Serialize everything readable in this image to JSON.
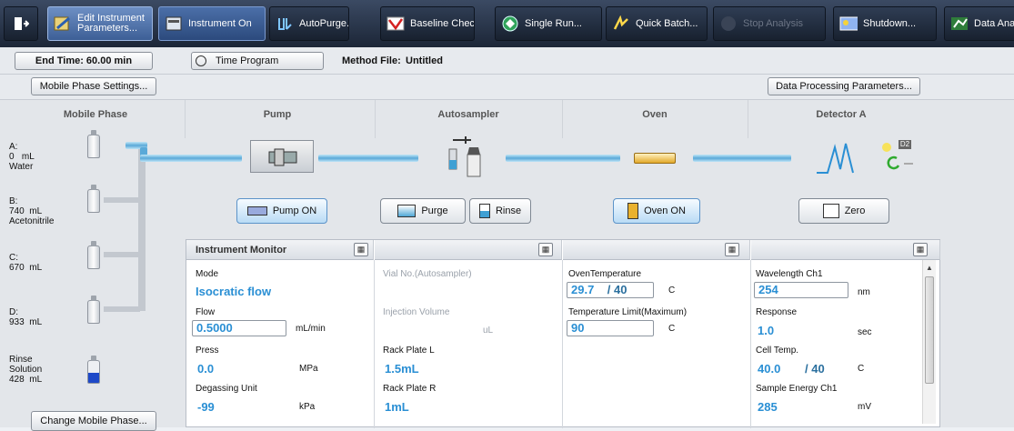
{
  "toolbar": {
    "edit_params": "Edit Instrument Parameters...",
    "instrument_on": "Instrument On",
    "autopurge": "AutoPurge...",
    "baseline_check": "Baseline Check",
    "single_run": "Single Run...",
    "quick_batch": "Quick Batch...",
    "stop_analysis": "Stop Analysis",
    "shutdown": "Shutdown...",
    "data_analysis": "Data Analy"
  },
  "row2": {
    "end_time": "End Time: 60.00 min",
    "time_program": "Time Program",
    "method_file_label": "Method File:",
    "method_file_value": "Untitled"
  },
  "row3": {
    "mobile_phase_settings": "Mobile Phase Settings...",
    "data_processing": "Data Processing Parameters..."
  },
  "columns": {
    "mobile_phase": "Mobile Phase",
    "pump": "Pump",
    "autosampler": "Autosampler",
    "oven": "Oven",
    "detector": "Detector A"
  },
  "mobile_phase": [
    {
      "letter": "A:",
      "amount": "0",
      "unit": "mL",
      "name": "Water"
    },
    {
      "letter": "B:",
      "amount": "740",
      "unit": "mL",
      "name": "Acetonitrile"
    },
    {
      "letter": "C:",
      "amount": "670",
      "unit": "mL",
      "name": ""
    },
    {
      "letter": "D:",
      "amount": "933",
      "unit": "mL",
      "name": ""
    }
  ],
  "rinse": {
    "l1": "Rinse",
    "l2": "Solution",
    "amount": "428",
    "unit": "mL"
  },
  "change_mobile_phase": "Change Mobile Phase...",
  "actions": {
    "pump_on": "Pump ON",
    "purge": "Purge",
    "rinse": "Rinse",
    "oven_on": "Oven ON",
    "zero": "Zero"
  },
  "detector_badge": "D2",
  "monitor": {
    "title": "Instrument Monitor",
    "pump": {
      "mode_label": "Mode",
      "mode_value": "Isocratic flow",
      "flow_label": "Flow",
      "flow_value": "0.5000",
      "flow_unit": "mL/min",
      "press_label": "Press",
      "press_value": "0.0",
      "press_unit": "MPa",
      "degas_label": "Degassing Unit",
      "degas_value": "-99",
      "degas_unit": "kPa"
    },
    "autosampler": {
      "vial_label": "Vial No.(Autosampler)",
      "inj_label": "Injection Volume",
      "inj_unit": "uL",
      "rack_l_label": "Rack Plate L",
      "rack_l_value": "1.5mL",
      "rack_r_label": "Rack Plate R",
      "rack_r_value": "1mL"
    },
    "oven": {
      "temp_label": "OvenTemperature",
      "temp_value": "29.7",
      "temp_set": "/ 40",
      "temp_unit": "C",
      "limit_label": "Temperature Limit(Maximum)",
      "limit_value": "90",
      "limit_unit": "C"
    },
    "detector": {
      "wl_label": "Wavelength Ch1",
      "wl_value": "254",
      "wl_unit": "nm",
      "resp_label": "Response",
      "resp_value": "1.0",
      "resp_unit": "sec",
      "cell_label": "Cell Temp.",
      "cell_value": "40.0",
      "cell_set": "/ 40",
      "cell_unit": "C",
      "energy_label": "Sample Energy Ch1",
      "energy_value": "285",
      "energy_unit": "mV"
    }
  }
}
